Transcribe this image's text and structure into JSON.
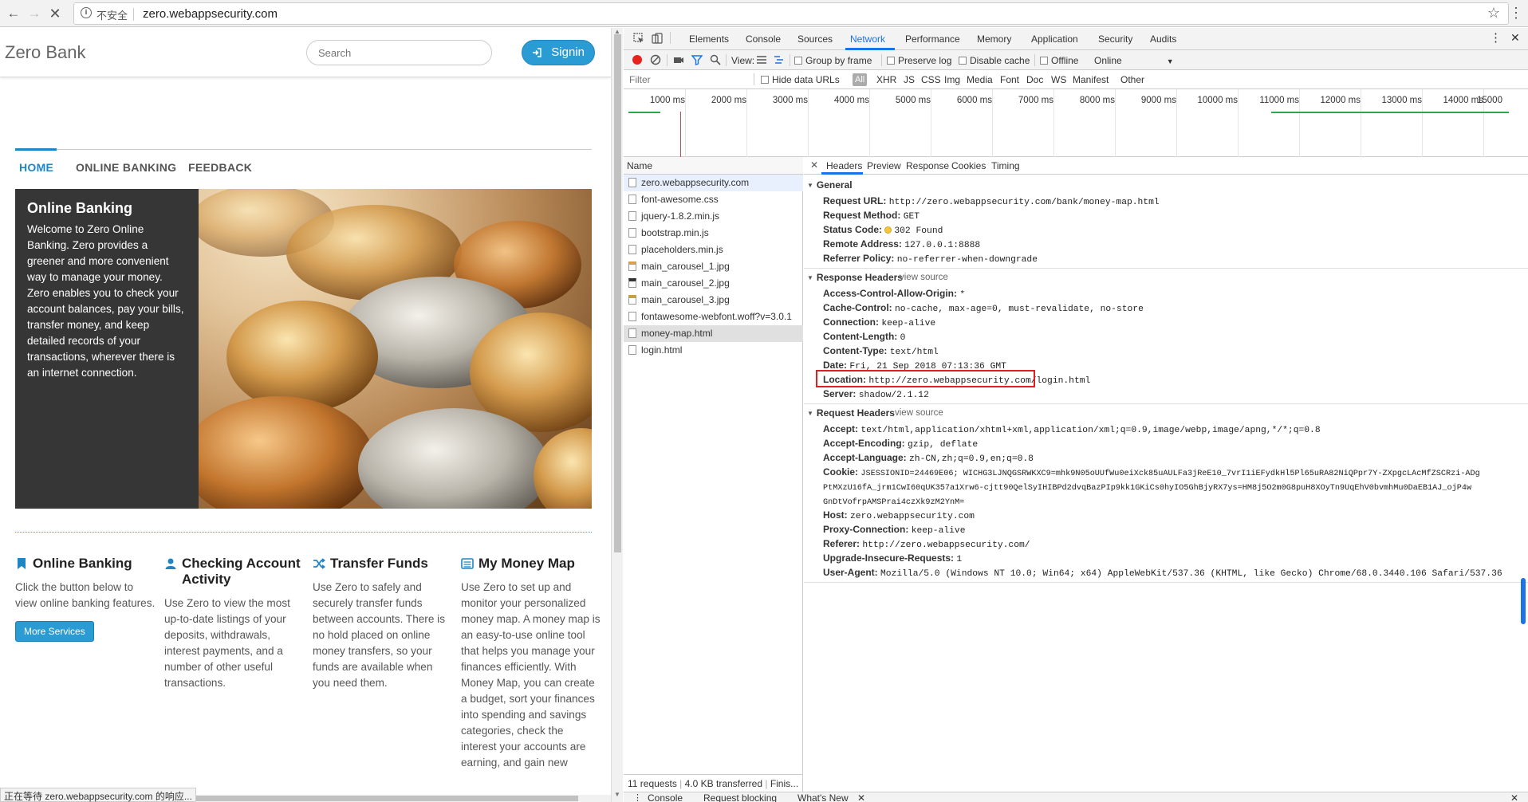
{
  "browser": {
    "url": "zero.webappsecurity.com",
    "security_label": "不安全",
    "info_icon": "i",
    "back_icon": "back-arrow-icon",
    "forward_icon": "forward-arrow-icon",
    "reload_icon": "stop-x-icon",
    "star_icon": "star-outline-icon",
    "menu_icon": "vertical-dots-icon"
  },
  "site": {
    "brand": "Zero Bank",
    "search_placeholder": "Search",
    "signin_label": "Signin",
    "tabs": [
      "HOME",
      "ONLINE BANKING",
      "FEEDBACK"
    ],
    "hero": {
      "title": "Online Banking",
      "body": "Welcome to Zero Online Banking. Zero provides a greener and more convenient way to manage your money. Zero enables you to check your account balances, pay your bills, transfer money, and keep detailed records of your transactions, wherever there is an internet connection."
    },
    "columns": [
      {
        "title": "Online Banking",
        "body": "Click the button below to view online banking features.",
        "icon": "bookmark-icon"
      },
      {
        "title": "Checking Account Activity",
        "body": "Use Zero to view the most up-to-date listings of your deposits, withdrawals, interest payments, and a number of other useful transactions.",
        "icon": "user-icon"
      },
      {
        "title": "Transfer Funds",
        "body": "Use Zero to safely and securely transfer funds between accounts. There is no hold placed on online money transfers, so your funds are available when you need them.",
        "icon": "shuffle-icon"
      },
      {
        "title": "My Money Map",
        "body": "Use Zero to set up and monitor your personalized money map. A money map is an easy-to-use online tool that helps you manage your finances efficiently. With Money Map, you can create a budget, sort your finances into spending and savings categories, check the interest your accounts are earning, and gain new",
        "icon": "list-alt-icon"
      }
    ],
    "more_services": "More Services",
    "status_text": "正在等待 zero.webappsecurity.com 的响应..."
  },
  "devtools": {
    "tabs": [
      "Elements",
      "Console",
      "Sources",
      "Network",
      "Performance",
      "Memory",
      "Application",
      "Security",
      "Audits"
    ],
    "active_tab": "Network",
    "toolbar": {
      "view_label": "View:",
      "group_by_frame": "Group by frame",
      "preserve_log": "Preserve log",
      "disable_cache": "Disable cache",
      "offline": "Offline",
      "throttle": "Online"
    },
    "filter": {
      "placeholder": "Filter",
      "hide_data_urls": "Hide data URLs",
      "types": [
        "All",
        "XHR",
        "JS",
        "CSS",
        "Img",
        "Media",
        "Font",
        "Doc",
        "WS",
        "Manifest",
        "Other"
      ]
    },
    "timeline_labels": [
      "1000 ms",
      "2000 ms",
      "3000 ms",
      "4000 ms",
      "5000 ms",
      "6000 ms",
      "7000 ms",
      "8000 ms",
      "9000 ms",
      "10000 ms",
      "11000 ms",
      "12000 ms",
      "13000 ms",
      "14000 ms",
      "15000"
    ],
    "list_header": "Name",
    "requests": [
      "zero.webappsecurity.com",
      "font-awesome.css",
      "jquery-1.8.2.min.js",
      "bootstrap.min.js",
      "placeholders.min.js",
      "main_carousel_1.jpg",
      "main_carousel_2.jpg",
      "main_carousel_3.jpg",
      "fontawesome-webfont.woff?v=3.0.1",
      "money-map.html",
      "login.html"
    ],
    "footer": {
      "requests": "11 requests",
      "transferred": "4.0 KB transferred",
      "finish": "Finis..."
    },
    "detail_tabs": [
      "Headers",
      "Preview",
      "Response",
      "Cookies",
      "Timing"
    ],
    "general": {
      "title": "General",
      "rows": [
        {
          "k": "Request URL:",
          "v": "http://zero.webappsecurity.com/bank/money-map.html"
        },
        {
          "k": "Request Method:",
          "v": "GET"
        },
        {
          "k": "Status Code:",
          "v": "302 Found"
        },
        {
          "k": "Remote Address:",
          "v": "127.0.0.1:8888"
        },
        {
          "k": "Referrer Policy:",
          "v": "no-referrer-when-downgrade"
        }
      ]
    },
    "response_headers": {
      "title": "Response Headers",
      "view_source": "view source",
      "rows": [
        {
          "k": "Access-Control-Allow-Origin:",
          "v": "*"
        },
        {
          "k": "Cache-Control:",
          "v": "no-cache, max-age=0, must-revalidate, no-store"
        },
        {
          "k": "Connection:",
          "v": "keep-alive"
        },
        {
          "k": "Content-Length:",
          "v": "0"
        },
        {
          "k": "Content-Type:",
          "v": "text/html"
        },
        {
          "k": "Date:",
          "v": "Fri, 21 Sep 2018 07:13:36 GMT"
        },
        {
          "k": "Location:",
          "v": "http://zero.webappsecurity.com/login.html"
        },
        {
          "k": "Server:",
          "v": "shadow/2.1.12"
        }
      ]
    },
    "request_headers": {
      "title": "Request Headers",
      "view_source": "view source",
      "rows": [
        {
          "k": "Accept:",
          "v": "text/html,application/xhtml+xml,application/xml;q=0.9,image/webp,image/apng,*/*;q=0.8"
        },
        {
          "k": "Accept-Encoding:",
          "v": "gzip, deflate"
        },
        {
          "k": "Accept-Language:",
          "v": "zh-CN,zh;q=0.9,en;q=0.8"
        },
        {
          "k": "Cookie:",
          "v": "JSESSIONID=24469E06; WICHG3LJNQGSRWKXC9=mhk9N05oUUfWu0eiXck85uAULFa3jReE10_7vrI1iEFydkHl5Pl65uRA82NiQPpr7Y-ZXpgcLAcMfZSCRzi-ADg"
        },
        {
          "k": "",
          "v": "PtMXzU16fA_jrm1CwI60qUK357a1Xrw6-cjtt90QelSyIHIBPd2dvqBazPIp9kk1GKiCs0hyIO5GhBjyRX7ys=HM8j5O2m0G8puH8XOyTn9UqEhV0bvmhMu0DaEB1AJ_ojP4w"
        },
        {
          "k": "",
          "v": "GnDtVofrpAMSPrai4czXk9zM2YnM="
        },
        {
          "k": "Host:",
          "v": "zero.webappsecurity.com"
        },
        {
          "k": "Proxy-Connection:",
          "v": "keep-alive"
        },
        {
          "k": "Referer:",
          "v": "http://zero.webappsecurity.com/"
        },
        {
          "k": "Upgrade-Insecure-Requests:",
          "v": "1"
        },
        {
          "k": "User-Agent:",
          "v": "Mozilla/5.0 (Windows NT 10.0; Win64; x64) AppleWebKit/537.36 (KHTML, like Gecko) Chrome/68.0.3440.106 Safari/537.36"
        }
      ]
    },
    "drawer_tabs": [
      "Console",
      "Request blocking",
      "What's New"
    ],
    "colors": {
      "accent": "#1a73e8",
      "highlight_box": "#e02020",
      "site_blue": "#2b9bd3",
      "status_dot": "#f6c73d"
    }
  }
}
